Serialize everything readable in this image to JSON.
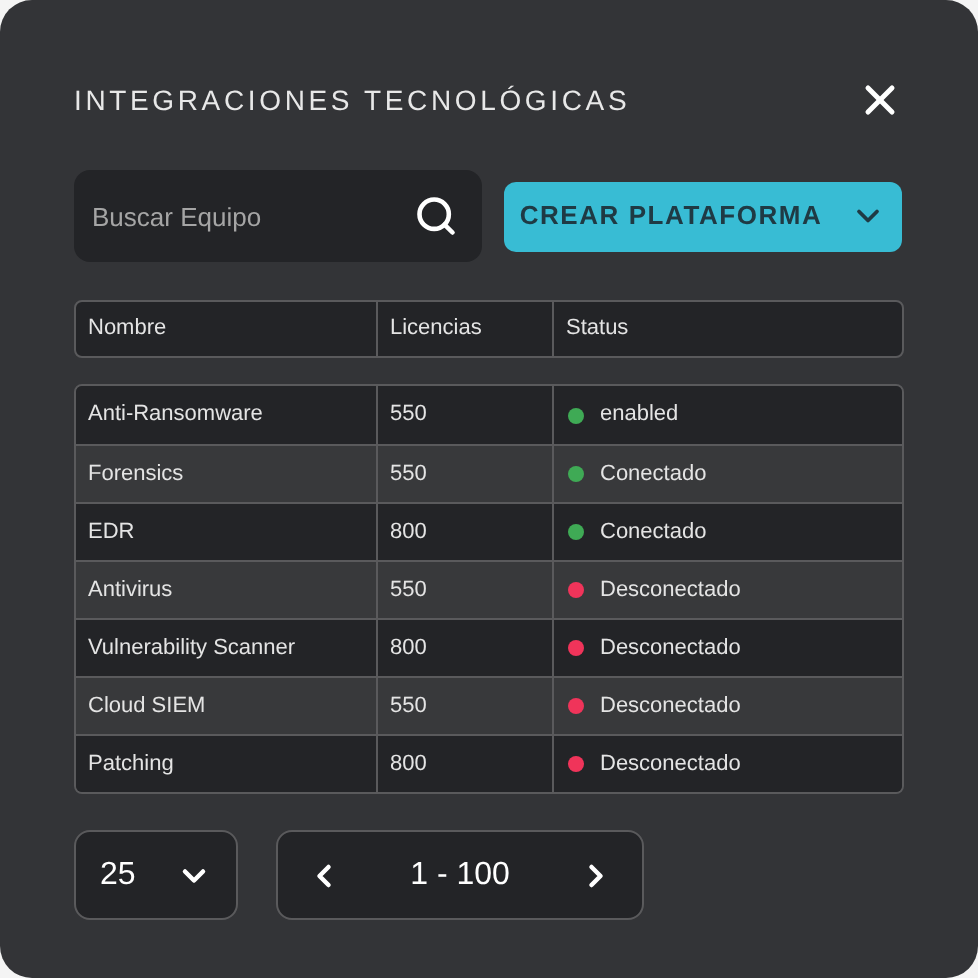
{
  "dialog": {
    "title": "INTEGRACIONES TECNOLÓGICAS"
  },
  "search": {
    "placeholder": "Buscar Equipo"
  },
  "create_button": {
    "label": "CREAR PLATAFORMA"
  },
  "table": {
    "columns": [
      "Nombre",
      "Licencias",
      "Status"
    ],
    "rows": [
      {
        "name": "Anti-Ransomware",
        "licenses": "550",
        "status": "enabled",
        "color": "#3faa55"
      },
      {
        "name": "Forensics",
        "licenses": "550",
        "status": "Conectado",
        "color": "#3faa55"
      },
      {
        "name": "EDR",
        "licenses": "800",
        "status": "Conectado",
        "color": "#3faa55"
      },
      {
        "name": "Antivirus",
        "licenses": "550",
        "status": "Desconectado",
        "color": "#f0345a"
      },
      {
        "name": "Vulnerability Scanner",
        "licenses": "800",
        "status": "Desconectado",
        "color": "#f0345a"
      },
      {
        "name": "Cloud SIEM",
        "licenses": "550",
        "status": "Desconectado",
        "color": "#f0345a"
      },
      {
        "name": "Patching",
        "licenses": "800",
        "status": "Desconectado",
        "color": "#f0345a"
      }
    ]
  },
  "pagination": {
    "page_size": "25",
    "range": "1 - 100"
  }
}
